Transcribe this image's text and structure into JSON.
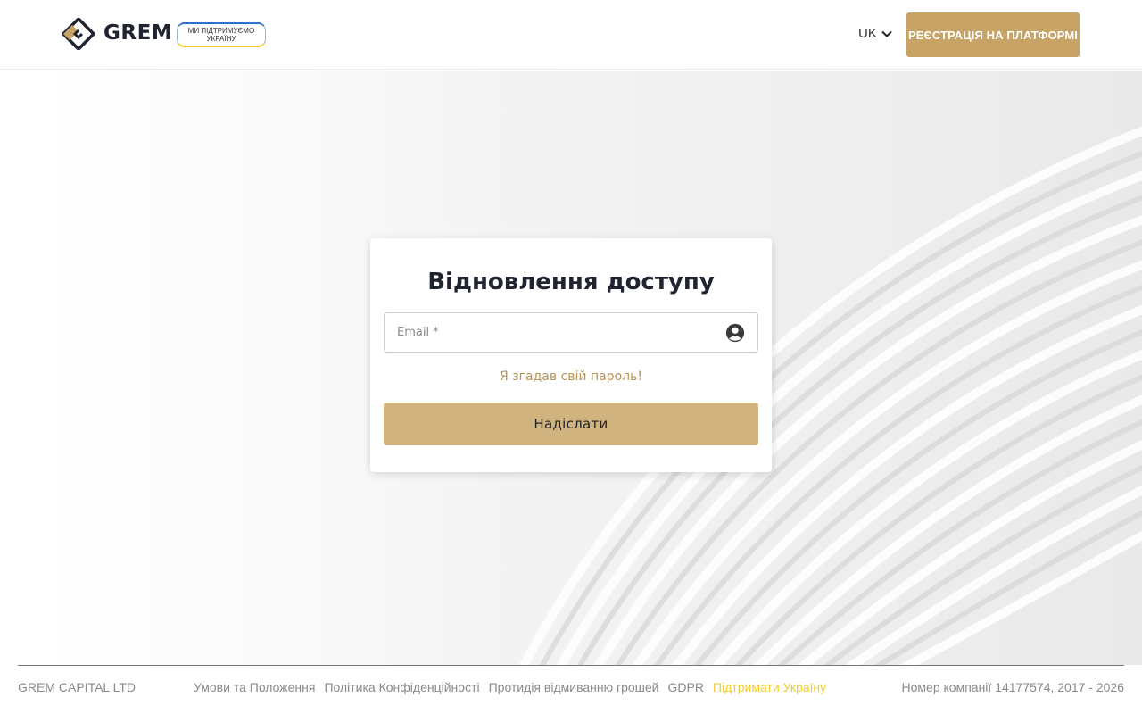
{
  "header": {
    "brand": "GREM",
    "ukraine_badge": {
      "line1": "МИ ПІДТРИМУЄМО",
      "line2": "УКРАЇНУ"
    },
    "language": "UK",
    "register_label": "РЕЄСТРАЦІЯ НА ПЛАТФОРМІ"
  },
  "form": {
    "title": "Відновлення доступу",
    "email_placeholder": "Email *",
    "email_value": "",
    "remember_link": "Я згадав свій пароль!",
    "submit_label": "Надіслати"
  },
  "footer": {
    "company": "GREM CAPITAL LTD",
    "links": [
      "Умови та Положення",
      "Політика Конфіденційності",
      "Протидія відмиванню грошей",
      "GDPR",
      "Підтримати Україну"
    ],
    "registration": "Номер компанії 14177574, 2017 - 2026"
  },
  "colors": {
    "accent": "#c7a465",
    "button": "#d0b37e",
    "link": "#b79457",
    "support_link": "#f2cd2a",
    "heading": "#1f2430"
  },
  "icons": {
    "logo": "grem-logo",
    "language_dropdown": "chevron-down-icon",
    "email_field": "user-circle-icon"
  }
}
